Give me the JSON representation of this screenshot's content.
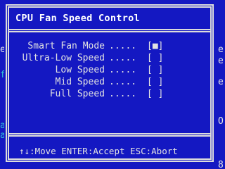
{
  "dialog": {
    "title": "CPU Fan Speed Control",
    "options": [
      {
        "label": "Smart Fan Mode",
        "dots": ".....",
        "check": "[■]"
      },
      {
        "label": "Ultra-Low Speed",
        "dots": ".....",
        "check": "[ ]"
      },
      {
        "label": "Low Speed",
        "dots": ".....",
        "check": "[ ]"
      },
      {
        "label": "Mid Speed",
        "dots": ".....",
        "check": "[ ]"
      },
      {
        "label": "Full Speed",
        "dots": ".....",
        "check": "[ ]"
      }
    ],
    "help": "↑↓:Move ENTER:Accept ESC:Abort"
  },
  "background": {
    "left": [
      {
        "text": "e",
        "color": "white"
      },
      {
        "text": "f",
        "color": "cyan"
      },
      {
        "text": "a",
        "color": "cyan"
      },
      {
        "text": "a",
        "color": "cyan"
      }
    ],
    "right": [
      {
        "text": "e"
      },
      {
        "text": "e"
      },
      {
        "text": "e"
      },
      {
        "text": "O"
      },
      {
        "text": "8"
      }
    ]
  }
}
